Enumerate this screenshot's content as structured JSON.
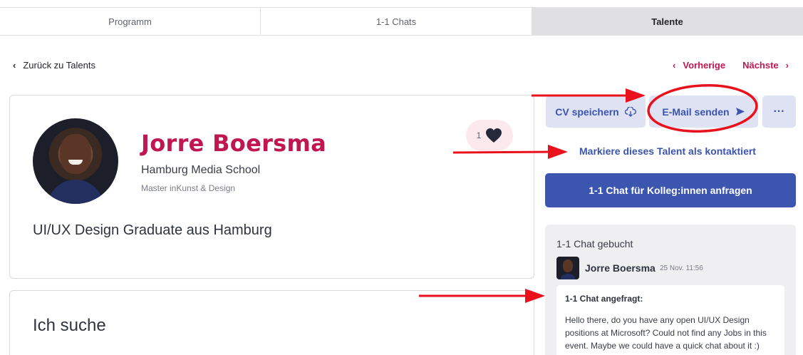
{
  "tabs": [
    {
      "label": "Programm"
    },
    {
      "label": "1-1 Chats"
    },
    {
      "label": "Talente"
    }
  ],
  "nav": {
    "back_label": "Zurück zu Talents",
    "prev_label": "Vorherige",
    "next_label": "Nächste"
  },
  "profile": {
    "name": "Jorre Boersma",
    "school": "Hamburg Media School",
    "program": "Master inKunst & Design",
    "headline": "UI/UX Design Graduate aus Hamburg",
    "like_count": "1"
  },
  "search_section": {
    "title": "Ich suche"
  },
  "actions": {
    "cv_label": "CV speichern",
    "email_label": "E-Mail senden",
    "more_label": "···",
    "mark_contacted_label": "Markiere dieses Talent als kontaktiert",
    "chat_request_label": "1-1 Chat für Kolleg:innen anfragen"
  },
  "chat": {
    "heading": "1-1 Chat gebucht",
    "sender": "Jorre Boersma",
    "time": "25 Nov. 11:56",
    "message_title": "1-1 Chat angefragt:",
    "message_text": "Hello there, do you have any open UI/UX Design positions at Microsoft? Could not find any Jobs in this event. Maybe we could have a quick chat about it :)"
  },
  "colors": {
    "accent": "#c0174f",
    "primary": "#3c56b0",
    "annotation": "#e8111c"
  },
  "icons": [
    "chevron-left-icon",
    "chevron-right-icon",
    "heart-icon",
    "cloud-download-icon",
    "send-icon",
    "more-icon"
  ]
}
